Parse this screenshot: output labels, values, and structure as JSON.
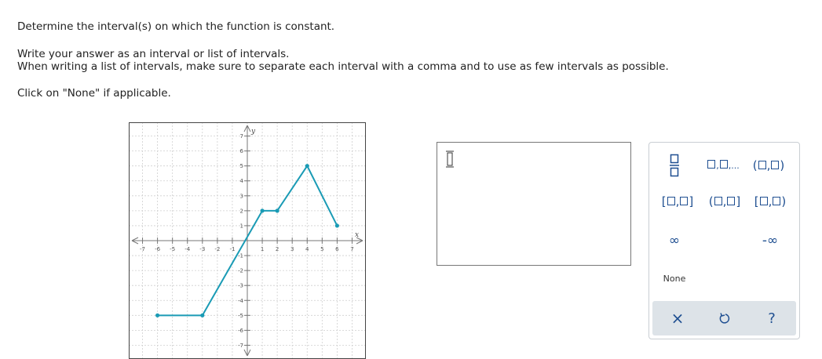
{
  "question": {
    "prompt": "Determine the interval(s) on which the function is constant.",
    "instruction_1": "Write your answer as an interval or list of intervals.",
    "instruction_2": "When writing a list of intervals, make sure to separate each interval with a comma and to use as few intervals as possible.",
    "instruction_3": "Click on \"None\" if applicable."
  },
  "graph": {
    "xlabel": "x",
    "ylabel": "y",
    "xlim": [
      -7,
      7
    ],
    "ylim": [
      -7,
      7
    ],
    "x_ticks": [
      -7,
      -6,
      -5,
      -4,
      -3,
      -2,
      -1,
      1,
      2,
      3,
      4,
      5,
      6,
      7
    ],
    "y_ticks": [
      7,
      6,
      5,
      4,
      3,
      2,
      1,
      -1,
      -2,
      -3,
      -4,
      -5,
      -6,
      -7
    ],
    "line_color": "#1a9bb5",
    "points": [
      [
        -6,
        -5
      ],
      [
        -3,
        -5
      ],
      [
        1,
        2
      ],
      [
        2,
        2
      ],
      [
        4,
        5
      ],
      [
        6,
        1
      ]
    ]
  },
  "answer": {
    "value": ""
  },
  "keypad": {
    "keys": {
      "fraction": "fraction-icon",
      "list": "□,□,...",
      "open_open": "(□,□)",
      "closed_closed": "[□,□]",
      "open_closed": "(□,□]",
      "closed_open": "[□,□)",
      "infinity": "∞",
      "neg_infinity": "-∞",
      "none": "None"
    },
    "footer": {
      "clear": "×",
      "undo": "undo-icon",
      "help": "?"
    }
  }
}
